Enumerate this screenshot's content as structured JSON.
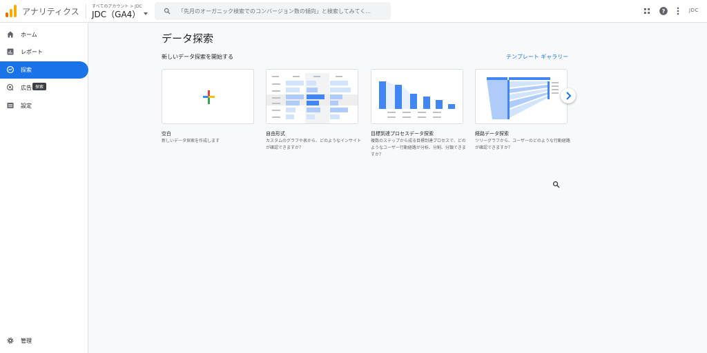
{
  "header": {
    "app_title": "アナリティクス",
    "account_breadcrumb": "すべてのアカウント > JDC",
    "account_name": "JDC（GA4）",
    "search_placeholder": "「先月のオーガニック検索でのコンバージョン数の傾向」と検索してみてく...",
    "brand_text": "JDC"
  },
  "sidebar": {
    "items": [
      {
        "label": "ホーム",
        "icon": "home-icon"
      },
      {
        "label": "レポート",
        "icon": "bar-chart-icon"
      },
      {
        "label": "探索",
        "icon": "explore-icon"
      },
      {
        "label": "広告",
        "icon": "advertising-icon"
      },
      {
        "label": "設定",
        "icon": "list-icon"
      }
    ],
    "active_index": 2,
    "tooltip": "探索",
    "admin_label": "管理"
  },
  "main": {
    "page_title": "データ探索",
    "section_title": "新しいデータ探索を開始する",
    "gallery_link": "テンプレート ギャラリー",
    "cards": [
      {
        "title": "空白",
        "description": "新しいデータ探索を作成します"
      },
      {
        "title": "自由形式",
        "description": "カスタムのグラフや表から、どのようなインサイトが確認できますか？"
      },
      {
        "title": "目標到達プロセスデータ探索",
        "description": "複数のステップから成る目標到達プロセスで、どのようなユーザー行動経路が分析、分割、分類できますか？"
      },
      {
        "title": "経路データ探索",
        "description": "ツリーグラフから、ユーザーのどのような行動経路が確認できますか？"
      }
    ]
  },
  "colors": {
    "accent": "#1a73e8",
    "ga_orange": "#f9ab00",
    "ga_dark_orange": "#e37400"
  }
}
